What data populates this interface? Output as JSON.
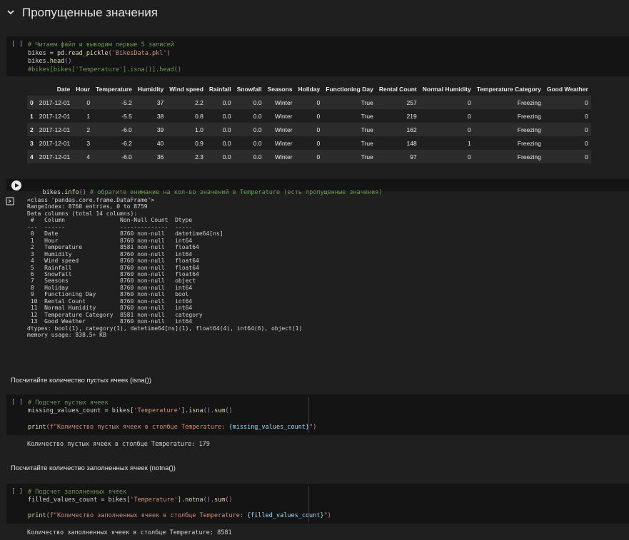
{
  "section": {
    "title": "Пропущенные значения"
  },
  "cell1": {
    "bracket": "[ ]",
    "lines": [
      [
        [
          "cmt",
          "# Читаем файл и выводим первые 5 записей"
        ]
      ],
      [
        [
          "kw",
          "bikes = pd."
        ],
        [
          "fn",
          "read_pickle"
        ],
        [
          "pl",
          "("
        ],
        [
          "str",
          "'BikesData.pkl'"
        ],
        [
          "pl",
          ")"
        ]
      ],
      [
        [
          "kw",
          "bikes."
        ],
        [
          "fn",
          "head"
        ],
        [
          "pl",
          "()"
        ]
      ],
      [
        [
          "cmt",
          "#bikes[bikes['Temperature'].isna()].head()"
        ]
      ]
    ]
  },
  "table": {
    "columns": [
      "",
      "Date",
      "Hour",
      "Temperature",
      "Humidity",
      "Wind speed",
      "Rainfall",
      "Snowfall",
      "Seasons",
      "Holiday",
      "Functioning Day",
      "Rental Count",
      "Normal Humidity",
      "Temperature Category",
      "Good Weather"
    ],
    "rows": [
      [
        "0",
        "2017-12-01",
        "0",
        "-5.2",
        "37",
        "2.2",
        "0.0",
        "0.0",
        "Winter",
        "0",
        "True",
        "257",
        "0",
        "Freezing",
        "0"
      ],
      [
        "1",
        "2017-12-01",
        "1",
        "-5.5",
        "38",
        "0.8",
        "0.0",
        "0.0",
        "Winter",
        "0",
        "True",
        "219",
        "0",
        "Freezing",
        "0"
      ],
      [
        "2",
        "2017-12-01",
        "2",
        "-6.0",
        "39",
        "1.0",
        "0.0",
        "0.0",
        "Winter",
        "0",
        "True",
        "162",
        "0",
        "Freezing",
        "0"
      ],
      [
        "3",
        "2017-12-01",
        "3",
        "-6.2",
        "40",
        "0.9",
        "0.0",
        "0.0",
        "Winter",
        "0",
        "True",
        "148",
        "1",
        "Freezing",
        "0"
      ],
      [
        "4",
        "2017-12-01",
        "4",
        "-6.0",
        "36",
        "2.3",
        "0.0",
        "0.0",
        "Winter",
        "0",
        "True",
        "97",
        "0",
        "Freezing",
        "0"
      ]
    ]
  },
  "cell2": {
    "code_a": "bikes.",
    "code_fn": "info",
    "code_paren": "()",
    "code_comment": " # обратите внимание на кол-во значений в Temperature (есть пропущенные значения)",
    "output": "<class 'pandas.core.frame.DataFrame'>\nRangeIndex: 8760 entries, 0 to 8759\nData columns (total 14 columns):\n #   Column                Non-Null Count  Dtype\n---  ------                --------------  -----\n 0   Date                  8760 non-null   datetime64[ns]\n 1   Hour                  8760 non-null   int64\n 2   Temperature           8581 non-null   float64\n 3   Humidity              8760 non-null   int64\n 4   Wind speed            8760 non-null   float64\n 5   Rainfall              8760 non-null   float64\n 6   Snowfall              8760 non-null   float64\n 7   Seasons               8760 non-null   object\n 8   Holiday               8760 non-null   int64\n 9   Functioning Day       8760 non-null   bool\n 10  Rental Count          8760 non-null   int64\n 11  Normal Humidity       8760 non-null   int64\n 12  Temperature Category  8581 non-null   category\n 13  Good Weather          8760 non-null   int64\ndtypes: bool(1), category(1), datetime64[ns](1), float64(4), int64(6), object(1)\nmemory usage: 838.5+ KB"
  },
  "md1": "Посчитайте количество пустых ячеек (isna())",
  "cell3": {
    "bracket": "[ ]",
    "comment": "# Подсчет пустых ячеек",
    "line1_a": "missing_values_count = bikes[",
    "line1_str": "'Temperature'",
    "line1_b": "].",
    "line1_fn1": "isna",
    "line1_p1": "().",
    "line1_fn2": "sum",
    "line1_p2": "()",
    "line2_fn": "print",
    "line2_open": "(",
    "line2_str": "f\"Количество пустых ячеек в столбце Temperature: ",
    "line2_var": "{missing_values_count}",
    "line2_end": "\"",
    "line2_close": ")",
    "output": "Количество пустых ячеек в столбце Temperature: 179"
  },
  "md2": "Посчитайте количество заполненных ячеек (notna())",
  "cell4": {
    "bracket": "[ ]",
    "comment": "# Подсчет заполненных ячеек",
    "line1_a": "filled_values_count = bikes[",
    "line1_str": "'Temperature'",
    "line1_b": "].",
    "line1_fn1": "notna",
    "line1_p1": "().",
    "line1_fn2": "sum",
    "line1_p2": "()",
    "line2_fn": "print",
    "line2_open": "(",
    "line2_str": "f\"Количество заполненных ячеек в столбце Temperature: ",
    "line2_var": "{filled_values_count}",
    "line2_end": "\"",
    "line2_close": ")",
    "output": "Количество заполненных ячеек в столбце Temperature: 8581"
  },
  "icons": {
    "collapse": "chevron-down-icon",
    "run": "play-icon",
    "output": "output-redirect-icon"
  }
}
